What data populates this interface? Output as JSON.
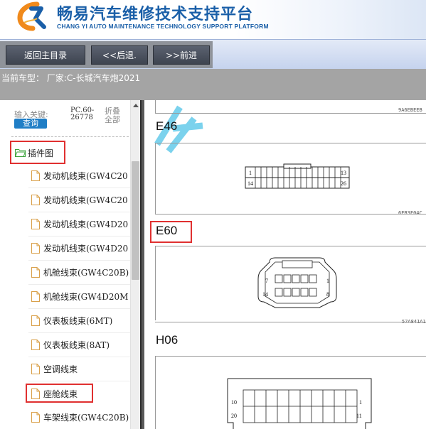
{
  "header": {
    "title_cn": "畅易汽车维修技术支持平台",
    "title_en": "CHANG YI AUTO MAINTENANCE TECHNOLOGY SUPPORT PLATFORM"
  },
  "toolbar": {
    "home_label": "返回主目录",
    "back_label": "<<后退.",
    "forward_label": ">>前进"
  },
  "vehicle": {
    "current_text": "当前车型： 厂家:C-长城汽车炮2021"
  },
  "left_panel": {
    "search_label": "输入关键:",
    "query_button": "查询",
    "pc_code_line1": "PC.60-",
    "pc_code_line2": "26778",
    "fold_line1": "折叠",
    "fold_line2": "全部",
    "folder_label": "插件图",
    "items": [
      {
        "label": "发动机线束(GW4C20"
      },
      {
        "label": "发动机线束(GW4C20"
      },
      {
        "label": "发动机线束(GW4D20"
      },
      {
        "label": "发动机线束(GW4D20"
      },
      {
        "label": "机舱线束(GW4C20B)"
      },
      {
        "label": "机舱线束(GW4D20M"
      },
      {
        "label": "仪表板线束(6MT)"
      },
      {
        "label": "仪表板线束(8AT)"
      },
      {
        "label": "空调线束"
      },
      {
        "label": "座舱线束"
      },
      {
        "label": "车架线束(GW4C20B)"
      }
    ]
  },
  "diagram": {
    "code_1": "9A6EBEEB",
    "label_e46": "E46",
    "e46_pins": {
      "p1": "1",
      "p14": "14",
      "p13": "13",
      "p26": "26"
    },
    "code_2": "6EB3F04C",
    "label_e60": "E60",
    "e60_pins": {
      "p7": "7",
      "p14": "14",
      "p1": "1",
      "p8": "8"
    },
    "code_3": "57A841A1",
    "label_h06": "H06",
    "h06_pins": {
      "p10": "10",
      "p20": "20",
      "p1": "1",
      "p11": "11"
    }
  },
  "colors": {
    "brand_blue": "#1a5fa8",
    "highlight_red": "#e03030",
    "query_blue": "#1f7ec6"
  }
}
